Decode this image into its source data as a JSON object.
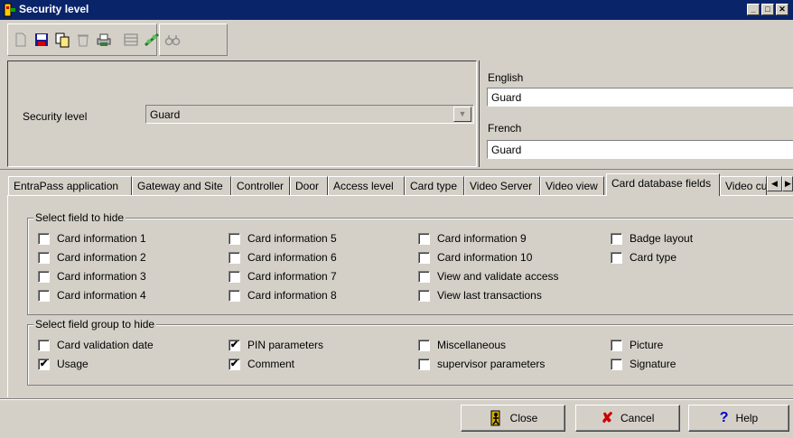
{
  "window": {
    "title": "Security level"
  },
  "security_level": {
    "label": "Security level",
    "value": "Guard"
  },
  "languages": [
    {
      "label": "English",
      "value": "Guard"
    },
    {
      "label": "French",
      "value": "Guard"
    }
  ],
  "tabs": [
    "EntraPass application",
    "Gateway and Site",
    "Controller",
    "Door",
    "Access level",
    "Card type",
    "Video Server",
    "Video view",
    "Card database fields",
    "Video cu"
  ],
  "active_tab": "Card database fields",
  "hide_fields": {
    "title": "Select field to hide",
    "items": [
      {
        "label": "Card information 1",
        "checked": false
      },
      {
        "label": "Card information 2",
        "checked": false
      },
      {
        "label": "Card information 3",
        "checked": false
      },
      {
        "label": "Card information 4",
        "checked": false
      },
      {
        "label": "Card information 5",
        "checked": false
      },
      {
        "label": "Card information 6",
        "checked": false
      },
      {
        "label": "Card information 7",
        "checked": false
      },
      {
        "label": "Card information 8",
        "checked": false
      },
      {
        "label": "Card information 9",
        "checked": false
      },
      {
        "label": "Card information 10",
        "checked": false
      },
      {
        "label": "View and validate access",
        "checked": false
      },
      {
        "label": "View last transactions",
        "checked": false
      },
      {
        "label": "Badge layout",
        "checked": false
      },
      {
        "label": "Card type",
        "checked": false
      }
    ]
  },
  "hide_groups": {
    "title": "Select field group to hide",
    "items": [
      {
        "label": "Card validation date",
        "checked": false
      },
      {
        "label": "Usage",
        "checked": true
      },
      {
        "label": "PIN parameters",
        "checked": true
      },
      {
        "label": "Comment",
        "checked": true
      },
      {
        "label": "Miscellaneous",
        "checked": false
      },
      {
        "label": "supervisor parameters",
        "checked": false
      },
      {
        "label": "Picture",
        "checked": false
      },
      {
        "label": "Signature",
        "checked": false
      }
    ]
  },
  "buttons": {
    "close": "Close",
    "cancel": "Cancel",
    "help": "Help"
  },
  "colors": {
    "titlebar": "#0a246a",
    "face": "#d4d0c8",
    "cancel_x": "#cc0000",
    "help_q": "#0000cc"
  }
}
